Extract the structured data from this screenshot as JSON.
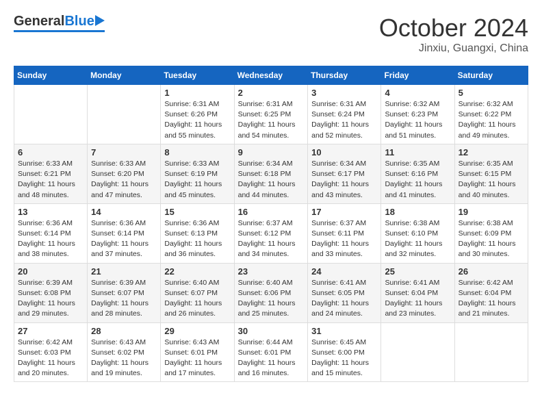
{
  "header": {
    "logo_general": "General",
    "logo_blue": "Blue",
    "month_title": "October 2024",
    "location": "Jinxiu, Guangxi, China"
  },
  "calendar": {
    "days_of_week": [
      "Sunday",
      "Monday",
      "Tuesday",
      "Wednesday",
      "Thursday",
      "Friday",
      "Saturday"
    ],
    "weeks": [
      [
        {
          "day": "",
          "sunrise": "",
          "sunset": "",
          "daylight": ""
        },
        {
          "day": "",
          "sunrise": "",
          "sunset": "",
          "daylight": ""
        },
        {
          "day": "1",
          "sunrise": "Sunrise: 6:31 AM",
          "sunset": "Sunset: 6:26 PM",
          "daylight": "Daylight: 11 hours and 55 minutes."
        },
        {
          "day": "2",
          "sunrise": "Sunrise: 6:31 AM",
          "sunset": "Sunset: 6:25 PM",
          "daylight": "Daylight: 11 hours and 54 minutes."
        },
        {
          "day": "3",
          "sunrise": "Sunrise: 6:31 AM",
          "sunset": "Sunset: 6:24 PM",
          "daylight": "Daylight: 11 hours and 52 minutes."
        },
        {
          "day": "4",
          "sunrise": "Sunrise: 6:32 AM",
          "sunset": "Sunset: 6:23 PM",
          "daylight": "Daylight: 11 hours and 51 minutes."
        },
        {
          "day": "5",
          "sunrise": "Sunrise: 6:32 AM",
          "sunset": "Sunset: 6:22 PM",
          "daylight": "Daylight: 11 hours and 49 minutes."
        }
      ],
      [
        {
          "day": "6",
          "sunrise": "Sunrise: 6:33 AM",
          "sunset": "Sunset: 6:21 PM",
          "daylight": "Daylight: 11 hours and 48 minutes."
        },
        {
          "day": "7",
          "sunrise": "Sunrise: 6:33 AM",
          "sunset": "Sunset: 6:20 PM",
          "daylight": "Daylight: 11 hours and 47 minutes."
        },
        {
          "day": "8",
          "sunrise": "Sunrise: 6:33 AM",
          "sunset": "Sunset: 6:19 PM",
          "daylight": "Daylight: 11 hours and 45 minutes."
        },
        {
          "day": "9",
          "sunrise": "Sunrise: 6:34 AM",
          "sunset": "Sunset: 6:18 PM",
          "daylight": "Daylight: 11 hours and 44 minutes."
        },
        {
          "day": "10",
          "sunrise": "Sunrise: 6:34 AM",
          "sunset": "Sunset: 6:17 PM",
          "daylight": "Daylight: 11 hours and 43 minutes."
        },
        {
          "day": "11",
          "sunrise": "Sunrise: 6:35 AM",
          "sunset": "Sunset: 6:16 PM",
          "daylight": "Daylight: 11 hours and 41 minutes."
        },
        {
          "day": "12",
          "sunrise": "Sunrise: 6:35 AM",
          "sunset": "Sunset: 6:15 PM",
          "daylight": "Daylight: 11 hours and 40 minutes."
        }
      ],
      [
        {
          "day": "13",
          "sunrise": "Sunrise: 6:36 AM",
          "sunset": "Sunset: 6:14 PM",
          "daylight": "Daylight: 11 hours and 38 minutes."
        },
        {
          "day": "14",
          "sunrise": "Sunrise: 6:36 AM",
          "sunset": "Sunset: 6:14 PM",
          "daylight": "Daylight: 11 hours and 37 minutes."
        },
        {
          "day": "15",
          "sunrise": "Sunrise: 6:36 AM",
          "sunset": "Sunset: 6:13 PM",
          "daylight": "Daylight: 11 hours and 36 minutes."
        },
        {
          "day": "16",
          "sunrise": "Sunrise: 6:37 AM",
          "sunset": "Sunset: 6:12 PM",
          "daylight": "Daylight: 11 hours and 34 minutes."
        },
        {
          "day": "17",
          "sunrise": "Sunrise: 6:37 AM",
          "sunset": "Sunset: 6:11 PM",
          "daylight": "Daylight: 11 hours and 33 minutes."
        },
        {
          "day": "18",
          "sunrise": "Sunrise: 6:38 AM",
          "sunset": "Sunset: 6:10 PM",
          "daylight": "Daylight: 11 hours and 32 minutes."
        },
        {
          "day": "19",
          "sunrise": "Sunrise: 6:38 AM",
          "sunset": "Sunset: 6:09 PM",
          "daylight": "Daylight: 11 hours and 30 minutes."
        }
      ],
      [
        {
          "day": "20",
          "sunrise": "Sunrise: 6:39 AM",
          "sunset": "Sunset: 6:08 PM",
          "daylight": "Daylight: 11 hours and 29 minutes."
        },
        {
          "day": "21",
          "sunrise": "Sunrise: 6:39 AM",
          "sunset": "Sunset: 6:07 PM",
          "daylight": "Daylight: 11 hours and 28 minutes."
        },
        {
          "day": "22",
          "sunrise": "Sunrise: 6:40 AM",
          "sunset": "Sunset: 6:07 PM",
          "daylight": "Daylight: 11 hours and 26 minutes."
        },
        {
          "day": "23",
          "sunrise": "Sunrise: 6:40 AM",
          "sunset": "Sunset: 6:06 PM",
          "daylight": "Daylight: 11 hours and 25 minutes."
        },
        {
          "day": "24",
          "sunrise": "Sunrise: 6:41 AM",
          "sunset": "Sunset: 6:05 PM",
          "daylight": "Daylight: 11 hours and 24 minutes."
        },
        {
          "day": "25",
          "sunrise": "Sunrise: 6:41 AM",
          "sunset": "Sunset: 6:04 PM",
          "daylight": "Daylight: 11 hours and 23 minutes."
        },
        {
          "day": "26",
          "sunrise": "Sunrise: 6:42 AM",
          "sunset": "Sunset: 6:04 PM",
          "daylight": "Daylight: 11 hours and 21 minutes."
        }
      ],
      [
        {
          "day": "27",
          "sunrise": "Sunrise: 6:42 AM",
          "sunset": "Sunset: 6:03 PM",
          "daylight": "Daylight: 11 hours and 20 minutes."
        },
        {
          "day": "28",
          "sunrise": "Sunrise: 6:43 AM",
          "sunset": "Sunset: 6:02 PM",
          "daylight": "Daylight: 11 hours and 19 minutes."
        },
        {
          "day": "29",
          "sunrise": "Sunrise: 6:43 AM",
          "sunset": "Sunset: 6:01 PM",
          "daylight": "Daylight: 11 hours and 17 minutes."
        },
        {
          "day": "30",
          "sunrise": "Sunrise: 6:44 AM",
          "sunset": "Sunset: 6:01 PM",
          "daylight": "Daylight: 11 hours and 16 minutes."
        },
        {
          "day": "31",
          "sunrise": "Sunrise: 6:45 AM",
          "sunset": "Sunset: 6:00 PM",
          "daylight": "Daylight: 11 hours and 15 minutes."
        },
        {
          "day": "",
          "sunrise": "",
          "sunset": "",
          "daylight": ""
        },
        {
          "day": "",
          "sunrise": "",
          "sunset": "",
          "daylight": ""
        }
      ]
    ]
  }
}
